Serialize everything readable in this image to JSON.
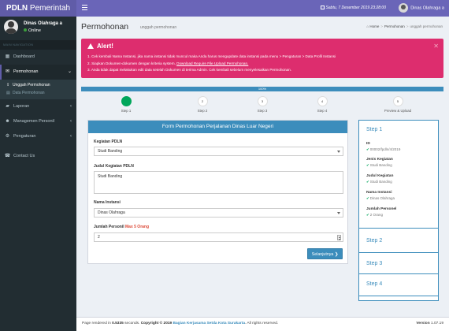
{
  "header": {
    "logo_bold": "PDLN",
    "logo_rest": " Pemerintah",
    "datetime": "Sabtu, 7 Desember 2019 23:28:00",
    "user_name": "Dinas Olahraga a"
  },
  "sidebar": {
    "user_name": "Dinas Olahraga a",
    "status": "Online",
    "nav_header": "MAIN NAVIGATION",
    "items": [
      {
        "label": "Dashboard",
        "icon": "dashboard-icon"
      },
      {
        "label": "Permohonan",
        "icon": "envelope-icon"
      },
      {
        "label": "Laporan",
        "icon": "folder-icon"
      },
      {
        "label": "Managemen Personil",
        "icon": "users-icon"
      },
      {
        "label": "Pengaturan",
        "icon": "gear-icon"
      },
      {
        "label": "Contact Us",
        "icon": "phone-icon"
      }
    ],
    "submenu": [
      {
        "label": "Unggah Permohonan"
      },
      {
        "label": "Data Permohonan"
      }
    ]
  },
  "content_header": {
    "title": "Permohonan",
    "subtitle": "unggah permohonan",
    "breadcrumb": [
      "Home",
      "Permohonan",
      "unggah permohonan"
    ]
  },
  "alert": {
    "title": "Alert!",
    "line1": "1. Cek kembali Nama Instansi, jika nama instansi tidak muncul maka Anda harus mengupdate data instansi pada menu > Pengaturan > Data Profil Instansi",
    "line2_pre": "2. Siapkan Dokumen-dokumen dengan kriteria system, ",
    "line2_link": "Download Require File Upload Permohonan.",
    "line3": "3. Anda tidak dapat melakukan edit data setelah Dokumen di terima Admin. Cek kembali sebelum menyelesaikan Permohonan."
  },
  "progress": {
    "label": "100%",
    "value": 100
  },
  "steps": [
    {
      "num": "",
      "label": "Step 1",
      "done": true
    },
    {
      "num": "2",
      "label": "Step 2",
      "done": false
    },
    {
      "num": "3",
      "label": "Step 3",
      "done": false
    },
    {
      "num": "4",
      "label": "Step 4",
      "done": false
    },
    {
      "num": "5",
      "label": "Preview & Upload",
      "done": false
    }
  ],
  "form": {
    "title": "Form Permohonan Perjalanan Dinas Luar Negeri",
    "kegiatan_label": "Kegiatan PDLN",
    "kegiatan_value": "Studi Banding",
    "judul_label": "Judul Kegiatan PDLN",
    "judul_value": "Studi Banding",
    "instansi_label": "Nama Instansi",
    "instansi_value": "Dinas Olahraga",
    "jumlah_label": "Jumlah Personil ",
    "jumlah_max": "Max 5 Orang",
    "jumlah_value": "2",
    "next_button": "Selanjutnya"
  },
  "summary": {
    "step1_title": "Step 1",
    "fields": [
      {
        "key": "ID",
        "value": "00002/fpdln/4/2019",
        "check": false
      },
      {
        "key": "Jenis Kegiatan",
        "value": "Studi Banding",
        "check": true
      },
      {
        "key": "Judul Kegiatan",
        "value": "Studi Banding",
        "check": true
      },
      {
        "key": "Nama Instansi",
        "value": "Dinas Olahraga",
        "check": true
      },
      {
        "key": "Jumlah Personel",
        "value": "2 Orang",
        "check": true
      }
    ],
    "step2_title": "Step 2",
    "step3_title": "Step 3",
    "step4_title": "Step 4"
  },
  "footer": {
    "pre": "Page rendered in ",
    "seconds": "0.5335",
    "mid": " seconds. ",
    "copyright": "Copyright © 2019 ",
    "org": "Bagian Kerjasama Setda Kota Surakarta",
    "post": ". All rights reserved.",
    "version_label": "Version",
    "version": " 1.07.19"
  }
}
